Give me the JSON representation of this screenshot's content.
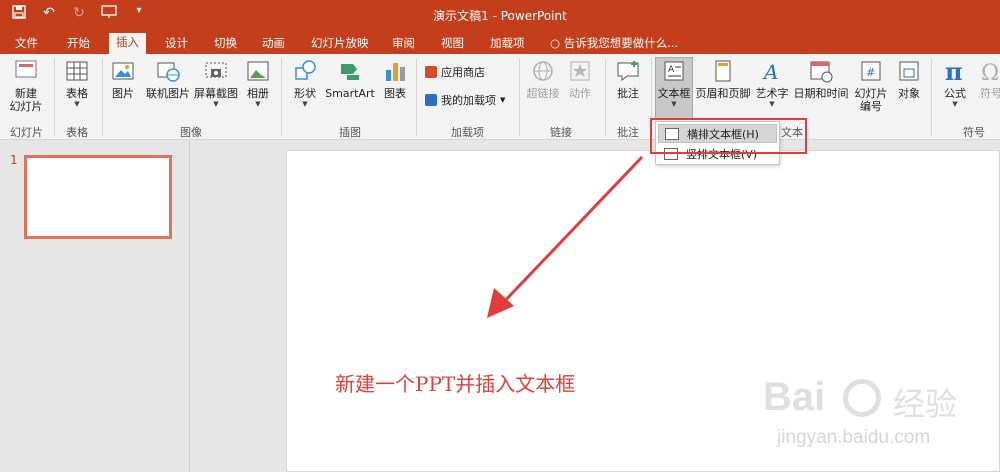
{
  "window": {
    "title": "演示文稿1 - PowerPoint"
  },
  "tabs": [
    {
      "label": "文件"
    },
    {
      "label": "开始"
    },
    {
      "label": "插入"
    },
    {
      "label": "设计"
    },
    {
      "label": "切换"
    },
    {
      "label": "动画"
    },
    {
      "label": "幻灯片放映"
    },
    {
      "label": "审阅"
    },
    {
      "label": "视图"
    },
    {
      "label": "加载项"
    }
  ],
  "tellme": "告诉我您想要做什么...",
  "ribbon": {
    "new_slide": "新建",
    "new_slide2": "幻灯片",
    "table": "表格",
    "picture": "图片",
    "online_picture": "联机图片",
    "screenshot": "屏幕截图",
    "album": "相册",
    "shapes": "形状",
    "smartart": "SmartArt",
    "chart": "图表",
    "store": "应用商店",
    "my_addins": "我的加载项",
    "hyperlink": "超链接",
    "action": "动作",
    "comment": "批注",
    "textbox": "文本框",
    "header_footer": "页眉和页脚",
    "wordart": "艺术字",
    "datetime": "日期和时间",
    "slide_number": "幻灯片",
    "slide_number2": "编号",
    "object": "对象",
    "equation": "公式",
    "symbol": "符号"
  },
  "groups": {
    "slides": "幻灯片",
    "tables": "表格",
    "images": "图像",
    "illustrations": "插图",
    "addins": "加载项",
    "links": "链接",
    "comments": "批注",
    "text": "文本",
    "symbols": "符号"
  },
  "dropdown": {
    "horizontal": "横排文本框(H)",
    "vertical": "竖排文本框(V)"
  },
  "thumbs": {
    "slide_number": "1"
  },
  "slide": {
    "caption": "新建一个PPT并插入文本框"
  },
  "watermark": {
    "brand": "Bai",
    "brand2": "经验",
    "url": "jingyan.baidu.com"
  },
  "colors": {
    "accent": "#c43e1c",
    "arrow": "#e33c3c"
  }
}
